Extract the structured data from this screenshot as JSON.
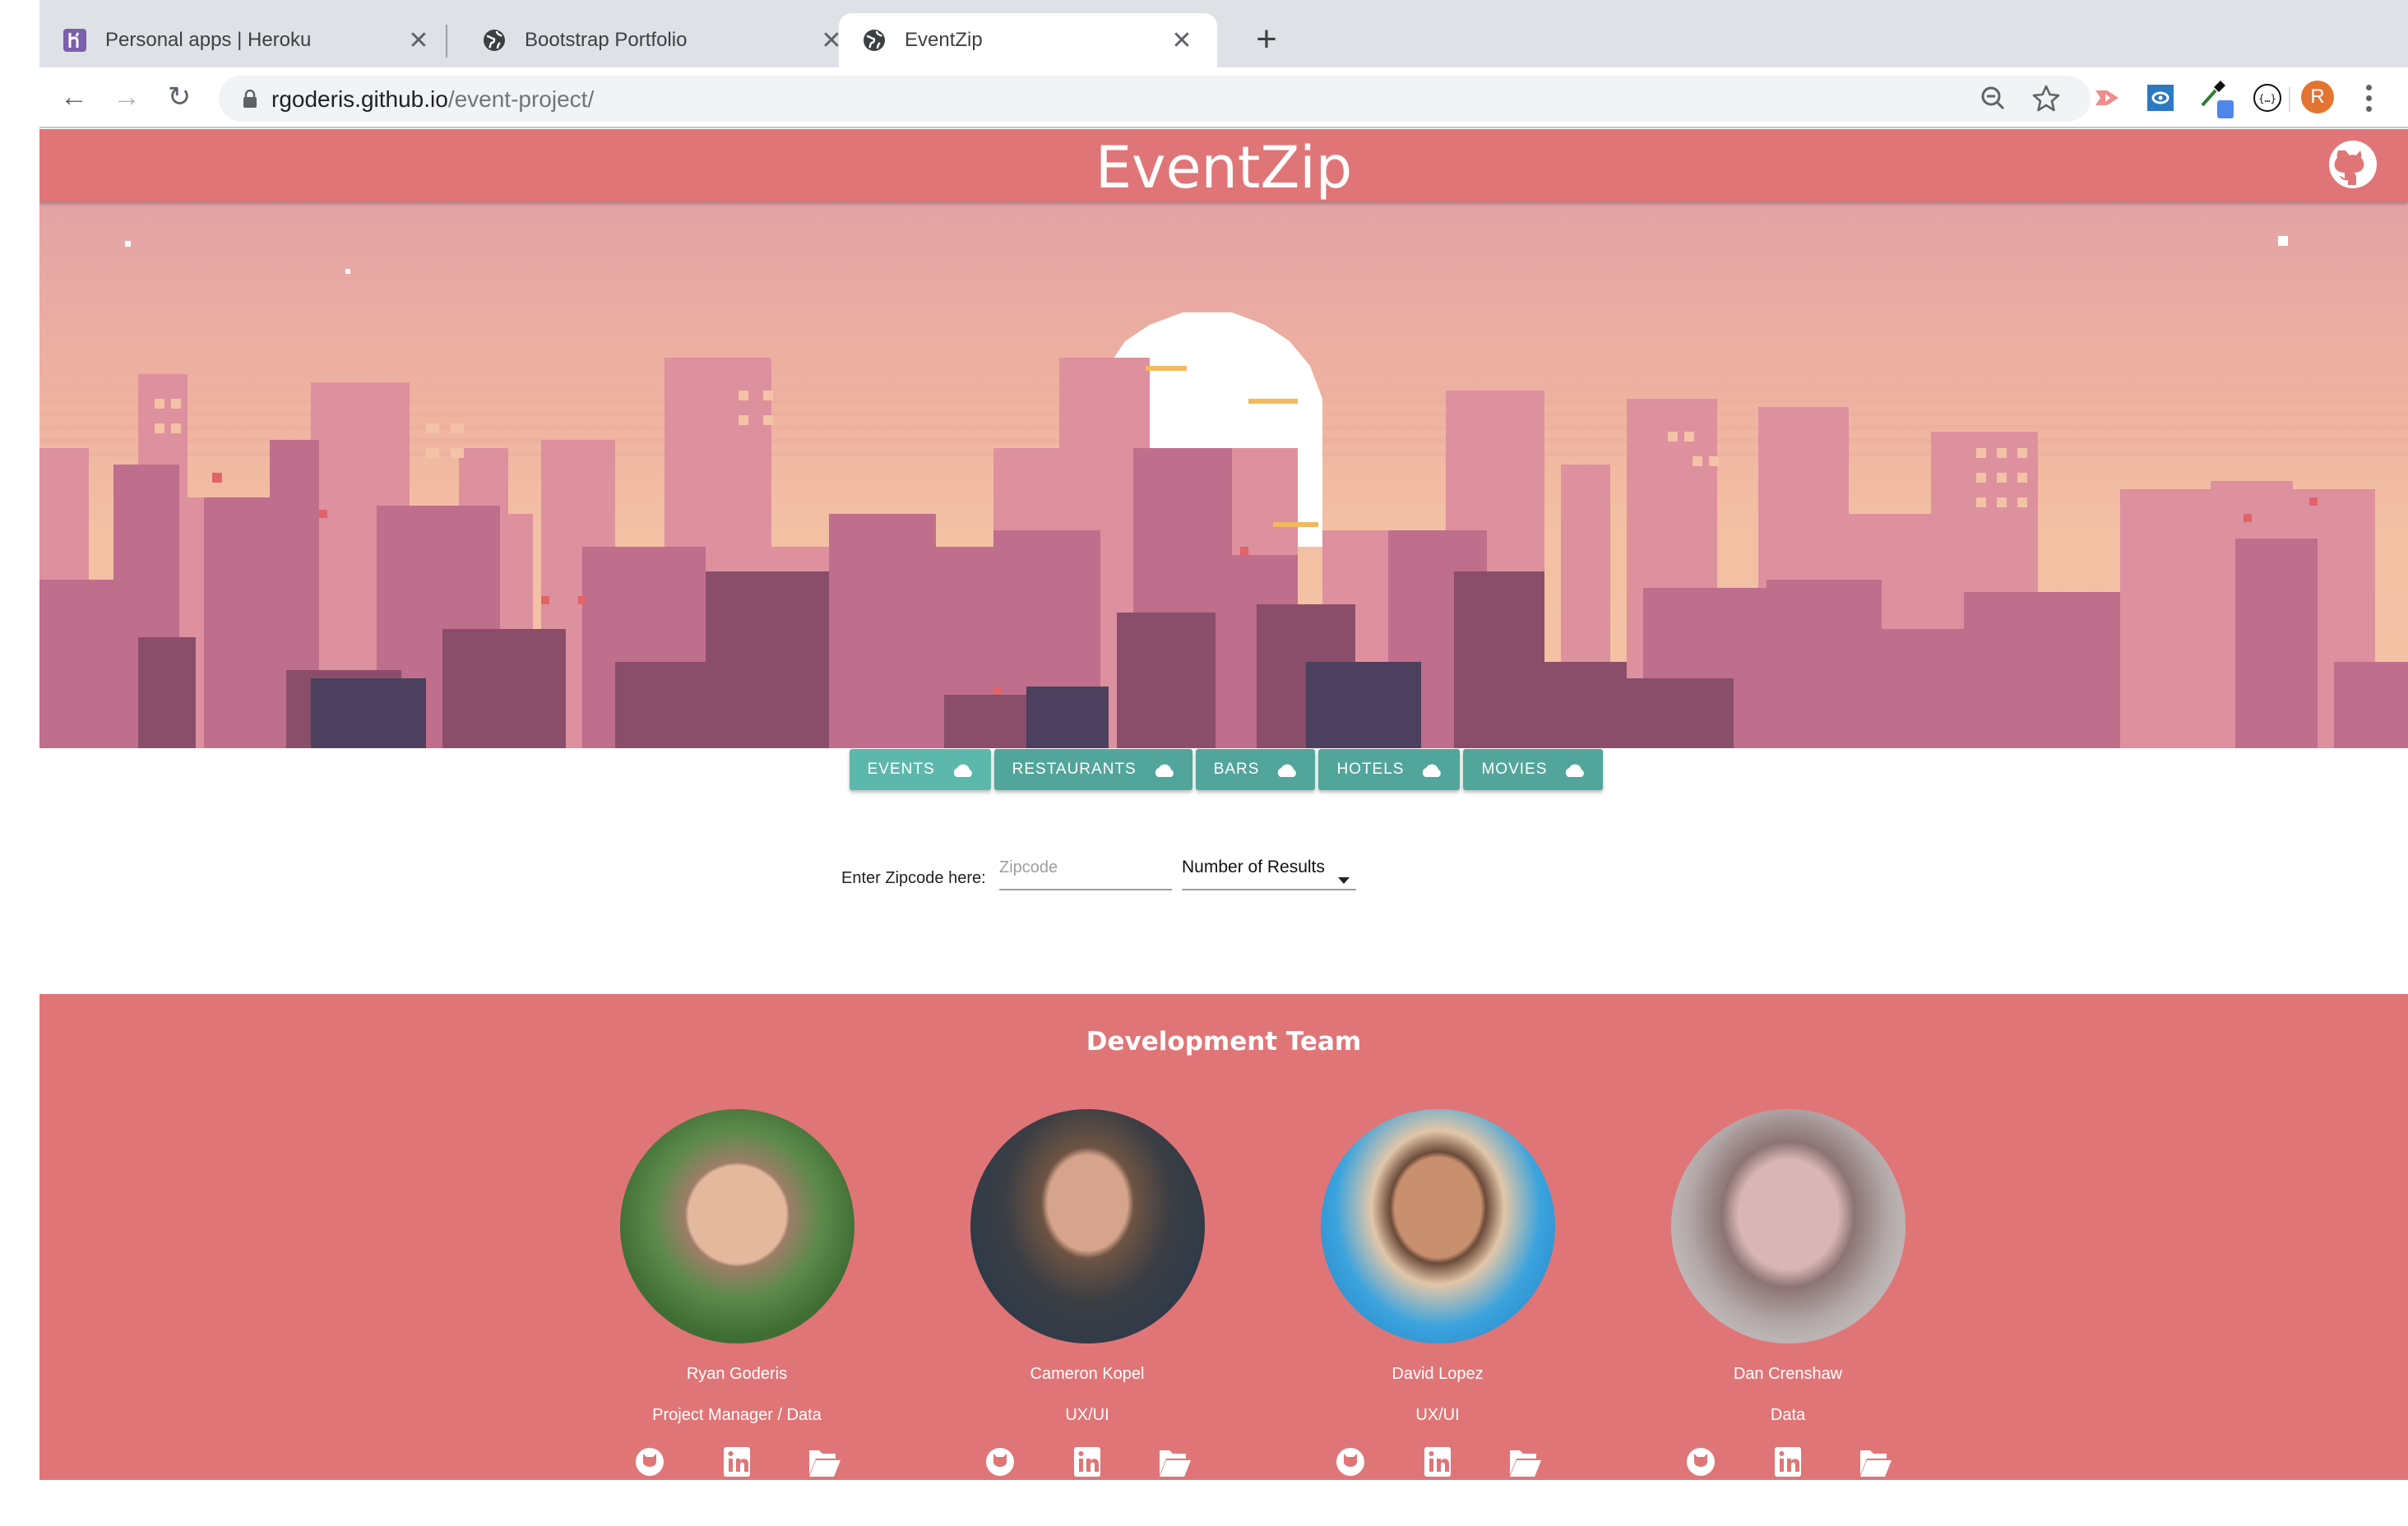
{
  "browser": {
    "tabs": [
      {
        "title": "Personal apps | Heroku",
        "favicon": "heroku-icon",
        "active": false
      },
      {
        "title": "Bootstrap Portfolio",
        "favicon": "globe-icon",
        "active": false
      },
      {
        "title": "EventZip",
        "favicon": "globe-icon",
        "active": true
      }
    ],
    "close_glyph": "✕",
    "new_tab_glyph": "+",
    "url_host": "rgoderis.github.io",
    "url_path": "/event-project/",
    "profile_initial": "R",
    "nav": {
      "back": "←",
      "forward": "→",
      "reload": "↻"
    }
  },
  "app": {
    "title": "EventZip",
    "accent_color": "#e07577",
    "button_color": "#52a59a"
  },
  "categories": [
    {
      "label": "EVENTS",
      "icon": "cloud-icon"
    },
    {
      "label": "RESTAURANTS",
      "icon": "cloud-icon"
    },
    {
      "label": "BARS",
      "icon": "cloud-icon"
    },
    {
      "label": "HOTELS",
      "icon": "cloud-icon"
    },
    {
      "label": "MOVIES",
      "icon": "cloud-icon"
    }
  ],
  "search": {
    "zip_label": "Enter Zipcode here:",
    "zip_placeholder": "Zipcode",
    "zip_value": "",
    "results_label": "Number of Results"
  },
  "team": {
    "title": "Development Team",
    "members": [
      {
        "name": "Ryan Goderis",
        "role": "Project Manager / Data"
      },
      {
        "name": "Cameron Kopel",
        "role": "UX/UI"
      },
      {
        "name": "David Lopez",
        "role": "UX/UI"
      },
      {
        "name": "Dan Crenshaw",
        "role": "Data"
      }
    ],
    "link_icons": [
      "github-icon",
      "linkedin-icon",
      "folder-open-icon"
    ]
  }
}
